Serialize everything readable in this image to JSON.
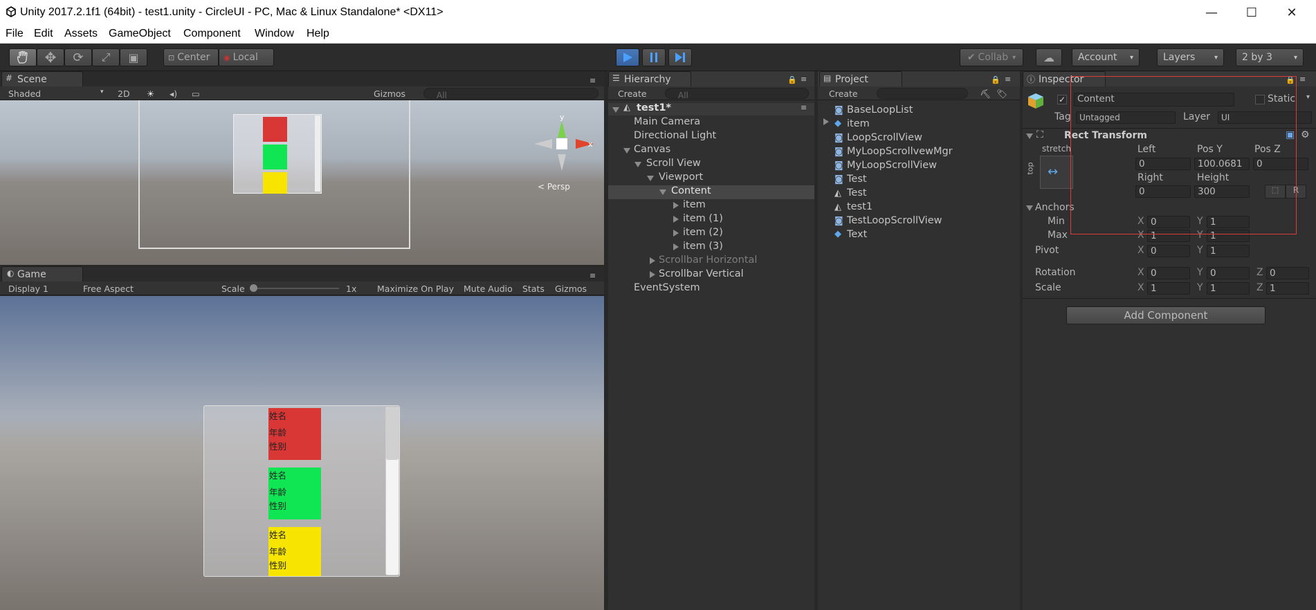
{
  "window": {
    "title": "Unity 2017.2.1f1 (64bit) - test1.unity - CircleUI - PC, Mac & Linux Standalone* <DX11>",
    "minimize_glyph": "—",
    "maximize_glyph": "☐",
    "close_glyph": "✕"
  },
  "menu": [
    "File",
    "Edit",
    "Assets",
    "GameObject",
    "Component",
    "Window",
    "Help"
  ],
  "toolbar": {
    "center": "Center",
    "local": "Local",
    "collab": "Collab",
    "account": "Account",
    "layers": "Layers",
    "layout": "2 by 3",
    "dropdown_glyph": "▾"
  },
  "scene": {
    "tab": "Scene",
    "shading": "Shaded",
    "mode_2d": "2D",
    "gizmos": "Gizmos",
    "search_placeholder": "All",
    "persp": "< Persp",
    "axis_x": "x",
    "axis_y": "y"
  },
  "game": {
    "tab": "Game",
    "display": "Display 1",
    "aspect": "Free Aspect",
    "scale_label": "Scale",
    "scale_value": "1x",
    "maximize": "Maximize On Play",
    "mute": "Mute Audio",
    "stats": "Stats",
    "gizmos": "Gizmos",
    "cards": [
      {
        "name": "姓名",
        "age": "年龄",
        "gender": "性别",
        "color": "#d93636"
      },
      {
        "name": "姓名",
        "age": "年龄",
        "gender": "性别",
        "color": "#10e654"
      },
      {
        "name": "姓名",
        "age": "年龄",
        "gender": "性别",
        "color": "#f7e400"
      }
    ]
  },
  "hierarchy": {
    "tab": "Hierarchy",
    "create": "Create",
    "search_placeholder": "All",
    "scene_name": "test1*",
    "items": [
      "Main Camera",
      "Directional Light",
      "Canvas",
      "Scroll View",
      "Viewport",
      "Content",
      "item",
      "item (1)",
      "item (2)",
      "item (3)",
      "Scrollbar Horizontal",
      "Scrollbar Vertical",
      "EventSystem"
    ]
  },
  "project": {
    "tab": "Project",
    "create": "Create",
    "items": [
      "BaseLoopList",
      "item",
      "LoopScrollView",
      "MyLoopScrollvewMgr",
      "MyLoopScrollView",
      "Test",
      "Test",
      "test1",
      "TestLoopScrollView",
      "Text"
    ]
  },
  "inspector": {
    "tab": "Inspector",
    "object_name": "Content",
    "static": "Static",
    "tag_label": "Tag",
    "tag_value": "Untagged",
    "layer_label": "Layer",
    "layer_value": "UI",
    "component": "Rect Transform",
    "stretch": "stretch",
    "top": "top",
    "left_label": "Left",
    "posy_label": "Pos Y",
    "posz_label": "Pos Z",
    "left": "0",
    "posy": "100.0681",
    "posz": "0",
    "right_label": "Right",
    "height_label": "Height",
    "right": "0",
    "height": "300",
    "r_button": "R",
    "anchors": "Anchors",
    "min": "Min",
    "max": "Max",
    "pivot": "Pivot",
    "rotation": "Rotation",
    "scale": "Scale",
    "x_label": "X",
    "y_label": "Y",
    "z_label": "Z",
    "min_x": "0",
    "min_y": "1",
    "max_x": "1",
    "max_y": "1",
    "pivot_x": "0",
    "pivot_y": "1",
    "rot_x": "0",
    "rot_y": "0",
    "rot_z": "0",
    "scale_x": "1",
    "scale_y": "1",
    "scale_z": "1",
    "add_component": "Add Component"
  },
  "colors": {
    "highlight_box": "#e03a3a",
    "play_blue": "#3a78d8"
  }
}
